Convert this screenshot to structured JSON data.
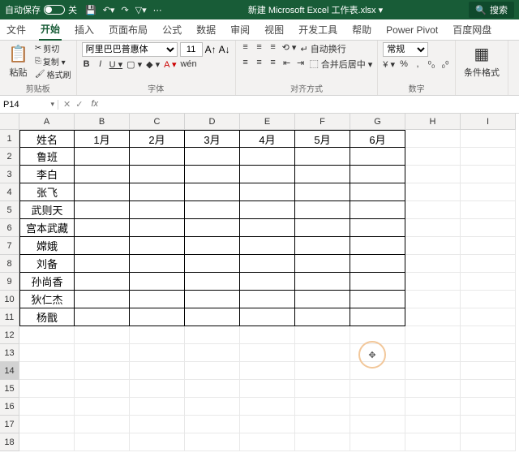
{
  "titlebar": {
    "autosave_label": "自动保存",
    "autosave_state": "关",
    "doc_title": "新建 Microsoft Excel 工作表.xlsx ▾",
    "search_label": "搜索"
  },
  "qat": {
    "save": "💾",
    "undo": "↶▾",
    "redo": "↷",
    "filter": "▽▾",
    "more": "⋯"
  },
  "tabs": {
    "file": "文件",
    "home": "开始",
    "insert": "插入",
    "layout": "页面布局",
    "formulas": "公式",
    "data": "数据",
    "review": "审阅",
    "view": "视图",
    "dev": "开发工具",
    "help": "帮助",
    "powerpivot": "Power Pivot",
    "baidu": "百度网盘"
  },
  "ribbon": {
    "clipboard": {
      "paste": "粘贴",
      "cut": "剪切",
      "copy": "复制 ▾",
      "painter": "格式刷",
      "label": "剪贴板"
    },
    "font": {
      "name": "阿里巴巴普惠体",
      "size": "11",
      "inc": "A↑",
      "dec": "A↓",
      "bold": "B",
      "italic": "I",
      "underline": "U ▾",
      "border": "▢ ▾",
      "fill": "◆ ▾",
      "color": "A ▾",
      "phonetic": "wén",
      "label": "字体"
    },
    "align": {
      "top": "≡",
      "mid": "≡",
      "bot": "≡",
      "left": "≡",
      "center": "≡",
      "right": "≡",
      "indent_dec": "⇤",
      "indent_inc": "⇥",
      "orient": "⟲ ▾",
      "wrap": "自动换行",
      "merge": "合并后居中 ▾",
      "label": "对齐方式"
    },
    "number": {
      "format": "常规",
      "currency": "¥ ▾",
      "percent": "%",
      "comma": ",",
      "inc_dec": "⁰₀",
      "dec_dec": "₀⁰",
      "label": "数字"
    },
    "styles": {
      "cond": "条件格式",
      "label": ""
    }
  },
  "namebox": {
    "ref": "P14",
    "cancel": "✕",
    "confirm": "✓",
    "fx": "fx"
  },
  "columns": [
    "A",
    "B",
    "C",
    "D",
    "E",
    "F",
    "G",
    "H",
    "I"
  ],
  "rows": [
    "1",
    "2",
    "3",
    "4",
    "5",
    "6",
    "7",
    "8",
    "9",
    "10",
    "11",
    "12",
    "13",
    "14",
    "15",
    "16",
    "17",
    "18"
  ],
  "table": {
    "header": [
      "姓名",
      "1月",
      "2月",
      "3月",
      "4月",
      "5月",
      "6月"
    ],
    "names": [
      "鲁班",
      "李白",
      "张飞",
      "武则天",
      "宫本武藏",
      "嫦娥",
      "刘备",
      "孙尚香",
      "狄仁杰",
      "杨戬"
    ]
  },
  "cursor_glyph": "✥"
}
